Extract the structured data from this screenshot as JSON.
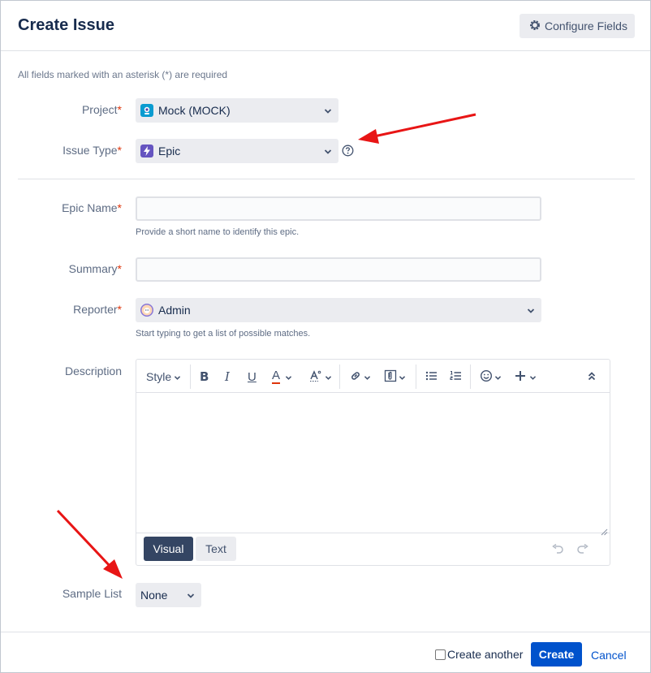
{
  "dialog": {
    "title": "Create Issue",
    "configure_fields_label": "Configure Fields",
    "required_note": "All fields marked with an asterisk (*) are required"
  },
  "fields": {
    "project": {
      "label": "Project",
      "asterisk": "*",
      "value": "Mock (MOCK)",
      "icon": "project-avatar-icon"
    },
    "issue_type": {
      "label": "Issue Type",
      "asterisk": "*",
      "value": "Epic",
      "icon": "epic-lightning-icon"
    },
    "epic_name": {
      "label": "Epic Name",
      "asterisk": "*",
      "value": "",
      "hint": "Provide a short name to identify this epic."
    },
    "summary": {
      "label": "Summary",
      "asterisk": "*",
      "value": ""
    },
    "reporter": {
      "label": "Reporter",
      "asterisk": "*",
      "value": "Admin",
      "hint": "Start typing to get a list of possible matches."
    },
    "description": {
      "label": "Description",
      "value": ""
    },
    "sample_list": {
      "label": "Sample List",
      "value": "None"
    }
  },
  "editor": {
    "style_label": "Style",
    "bold_label": "B",
    "italic_label": "I",
    "underline_label": "U",
    "text_color_label": "A",
    "visual_label": "Visual",
    "text_label": "Text"
  },
  "footer": {
    "create_another_label": "Create another",
    "create_another_checked": false,
    "create_label": "Create",
    "cancel_label": "Cancel"
  },
  "colors": {
    "primary": "#0052cc",
    "required": "#de350b",
    "annotation_arrow": "#e81515",
    "epic": "#6554c0"
  }
}
